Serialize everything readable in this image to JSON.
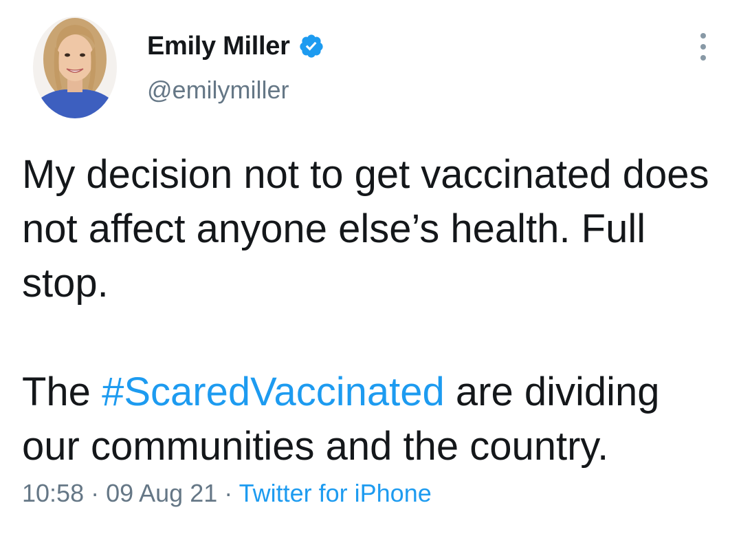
{
  "author": {
    "display_name": "Emily Miller",
    "handle": "@emilymiller",
    "verified": true
  },
  "tweet": {
    "line1": "My decision not to get vaccinated does not affect anyone else’s health. Full stop.",
    "line2_before": "The ",
    "hashtag": "#ScaredVaccinated",
    "line2_after": " are dividing our communities and the country."
  },
  "meta": {
    "time": "10:58",
    "sep1": " · ",
    "date": "09 Aug 21",
    "sep2": " · ",
    "source": "Twitter for iPhone"
  },
  "icons": {
    "verified": "verified-badge-icon",
    "more": "more-options-icon"
  },
  "colors": {
    "link": "#1d9bf0",
    "text": "#14171a",
    "muted": "#657786"
  }
}
